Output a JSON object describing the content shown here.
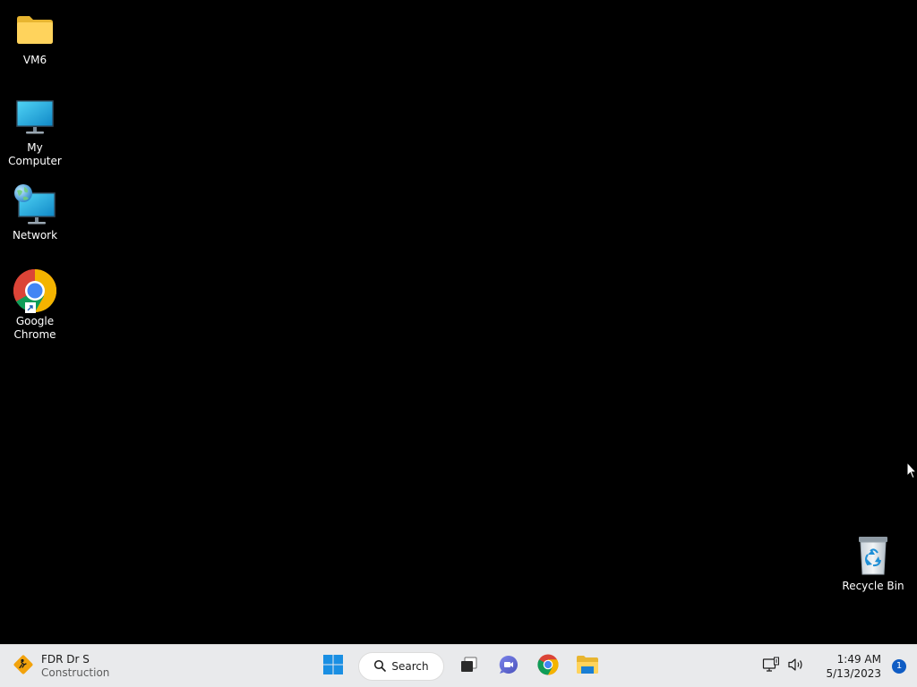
{
  "desktop": {
    "icons": [
      {
        "label": "VM6",
        "icon": "folder-icon"
      },
      {
        "label": "My Computer",
        "icon": "monitor-icon"
      },
      {
        "label": "Network",
        "icon": "network-icon"
      },
      {
        "label": "Google\nChrome",
        "icon": "chrome-icon"
      },
      {
        "label": "Recycle Bin",
        "icon": "recycle-bin-icon"
      }
    ]
  },
  "taskbar": {
    "weather": {
      "title": "FDR Dr S",
      "subtitle": "Construction",
      "icon": "construction-warning-icon"
    },
    "start_icon": "windows-start-icon",
    "search_label": "Search",
    "pinned": [
      {
        "name": "task-view",
        "icon": "task-view-icon"
      },
      {
        "name": "teams-chat",
        "icon": "teams-chat-icon"
      },
      {
        "name": "chrome",
        "icon": "chrome-icon"
      },
      {
        "name": "file-explorer",
        "icon": "file-explorer-icon"
      }
    ],
    "tray": {
      "network_icon": "network-status-icon",
      "volume_icon": "volume-icon",
      "time": "1:49 AM",
      "date": "5/13/2023",
      "notification_count": "1"
    }
  },
  "colors": {
    "desktop_background": "#000000",
    "taskbar_background": "#e9eaec",
    "accent": "#0f5cc4"
  }
}
